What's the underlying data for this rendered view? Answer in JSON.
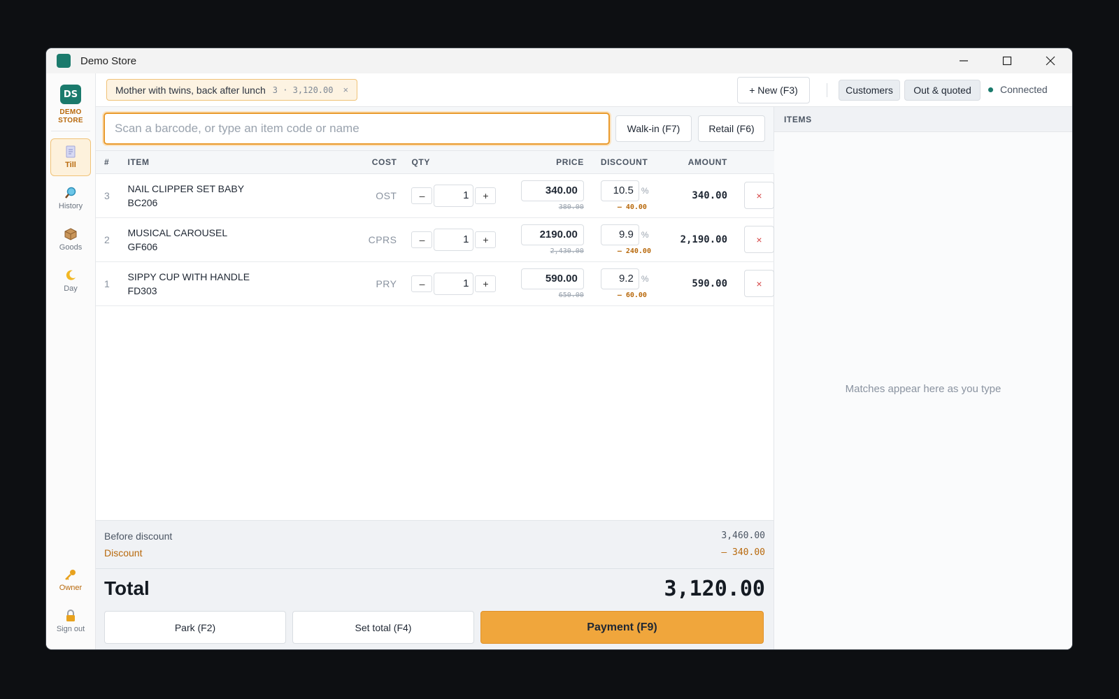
{
  "window": {
    "title": "Demo Store"
  },
  "sidebar": {
    "logo_initials": "DS",
    "logo_line1": "DEMO",
    "logo_line2": "STORE",
    "items": [
      {
        "label": "Till",
        "icon": "receipt-icon"
      },
      {
        "label": "History",
        "icon": "magnifier-icon"
      },
      {
        "label": "Goods",
        "icon": "package-icon"
      },
      {
        "label": "Day",
        "icon": "moon-icon"
      }
    ],
    "bottom": [
      {
        "label": "Owner",
        "icon": "key-icon"
      },
      {
        "label": "Sign out",
        "icon": "lock-icon"
      }
    ]
  },
  "topbar": {
    "parked_sale": {
      "label": "Mother with twins, back after lunch",
      "meta": "3 · 3,120.00",
      "close": "×"
    },
    "new_label": "+ New (F3)",
    "customers_label": "Customers",
    "out_quoted_label": "Out & quoted",
    "status": "Connected"
  },
  "search": {
    "placeholder": "Scan a barcode, or type an item code or name",
    "walkin_label": "Walk-in (F7)",
    "retail_label": "Retail (F6)"
  },
  "table": {
    "headers": {
      "num": "#",
      "item": "ITEM",
      "cost": "COST",
      "qty": "QTY",
      "price": "PRICE",
      "discount": "DISCOUNT",
      "amount": "AMOUNT"
    },
    "rows": [
      {
        "num": "3",
        "name": "NAIL CLIPPER SET BABY",
        "code": "BC206",
        "cost": "OST",
        "qty": "1",
        "price": "340.00",
        "orig": "380.00",
        "disc_pct": "10.5",
        "disc_amt": "– 40.00",
        "amount": "340.00"
      },
      {
        "num": "2",
        "name": "MUSICAL CAROUSEL",
        "code": "GF606",
        "cost": "CPRS",
        "qty": "1",
        "price": "2190.00",
        "orig": "2,430.00",
        "disc_pct": "9.9",
        "disc_amt": "– 240.00",
        "amount": "2,190.00"
      },
      {
        "num": "1",
        "name": "SIPPY CUP WITH HANDLE",
        "code": "FD303",
        "cost": "PRY",
        "qty": "1",
        "price": "590.00",
        "orig": "650.00",
        "disc_pct": "9.2",
        "disc_amt": "– 60.00",
        "amount": "590.00"
      }
    ],
    "pct_symbol": "%",
    "minus": "–",
    "plus": "+",
    "remove": "×"
  },
  "summary": {
    "before_label": "Before discount",
    "before_value": "3,460.00",
    "discount_label": "Discount",
    "discount_value": "– 340.00",
    "total_label": "Total",
    "total_value": "3,120.00"
  },
  "actions": {
    "park": "Park (F2)",
    "set_total": "Set total (F4)",
    "payment": "Payment (F9)"
  },
  "items_panel": {
    "header": "ITEMS",
    "empty": "Matches appear here as you type"
  },
  "colors": {
    "accent": "#f0a63c",
    "brand": "#1a7a6c",
    "discount": "#b8690c"
  }
}
